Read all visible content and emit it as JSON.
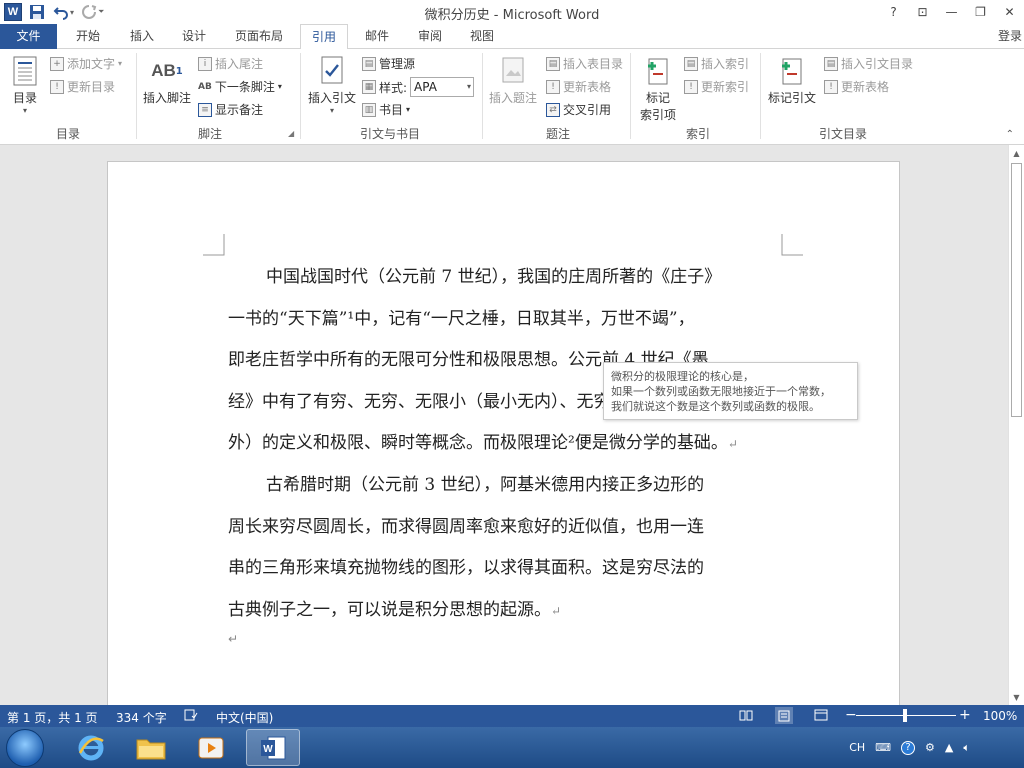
{
  "window": {
    "title": "微积分历史 - Microsoft Word",
    "app_icon": "W",
    "controls": {
      "help": "?",
      "ribbon_display": "⊡",
      "minimize": "—",
      "restore": "❐",
      "close": "✕"
    }
  },
  "qat": {
    "save": "save-icon",
    "undo": "undo-icon",
    "redo": "redo-icon",
    "customize": "customize-icon"
  },
  "tabs": [
    "文件",
    "开始",
    "插入",
    "设计",
    "页面布局",
    "引用",
    "邮件",
    "审阅",
    "视图"
  ],
  "active_tab": "引用",
  "login_label": "登录",
  "ribbon": {
    "toc": {
      "big": "目录",
      "add_text": "添加文字",
      "update_table": "更新目录",
      "group": "目录"
    },
    "footnotes": {
      "big": "插入脚注",
      "big_icon_text": "AB",
      "insert_endnote": "插入尾注",
      "next_footnote": "下一条脚注",
      "show_notes": "显示备注",
      "group": "脚注"
    },
    "citations": {
      "big": "插入引文",
      "manage_sources": "管理源",
      "style_label": "样式:",
      "style_value": "APA",
      "bibliography": "书目",
      "group": "引文与书目"
    },
    "captions": {
      "big": "插入题注",
      "insert_tof": "插入表目录",
      "update_table": "更新表格",
      "cross_ref": "交叉引用",
      "group": "题注"
    },
    "index": {
      "big_line1": "标记",
      "big_line2": "索引项",
      "insert_index": "插入索引",
      "update_index": "更新索引",
      "group": "索引"
    },
    "toa": {
      "big": "标记引文",
      "insert_toa": "插入引文目录",
      "update_table": "更新表格",
      "group": "引文目录"
    }
  },
  "document": {
    "paragraph1_lines": [
      "中国战国时代（公元前 7 世纪），我国的庄周所著的《庄子》",
      "一书的“天下篇”¹中，记有“一尺之棰，日取其半，万世不竭”，",
      "即老庄哲学中所有的无限可分性和极限思想。公元前 4 世纪《墨",
      "经》中有了有穷、无穷、无限小（最小无内）、无穷大（最大无",
      "外）的定义和极限、瞬时等概念。而极限理论²便是微分学的基础。"
    ],
    "paragraph2_lines": [
      "古希腊时期（公元前 3 世纪），阿基米德用内接正多边形的",
      "周长来穷尽圆周长，而求得圆周率愈来愈好的近似值，也用一连",
      "串的三角形来填充抛物线的图形，以求得其面积。这是穷尽法的",
      "古典例子之一，可以说是积分思想的起源。"
    ],
    "paragraph_mark": "↵"
  },
  "tooltip": {
    "lines": [
      "微积分的极限理论的核心是，",
      "如果一个数列或函数无限地接近于一个常数，",
      "我们就说这个数是这个数列或函数的极限。"
    ]
  },
  "statusbar": {
    "page": "第 1 页，共 1 页",
    "words": "334 个字",
    "language": "中文(中国)",
    "zoom": "100%",
    "zoom_minus": "−",
    "zoom_plus": "+"
  },
  "taskbar": {
    "apps": [
      "internet-explorer-icon",
      "file-explorer-icon",
      "media-player-icon",
      "word-icon"
    ],
    "tray_ime": "CH"
  },
  "colors": {
    "accent": "#2b579a",
    "taskbar": "#2a5a97"
  }
}
